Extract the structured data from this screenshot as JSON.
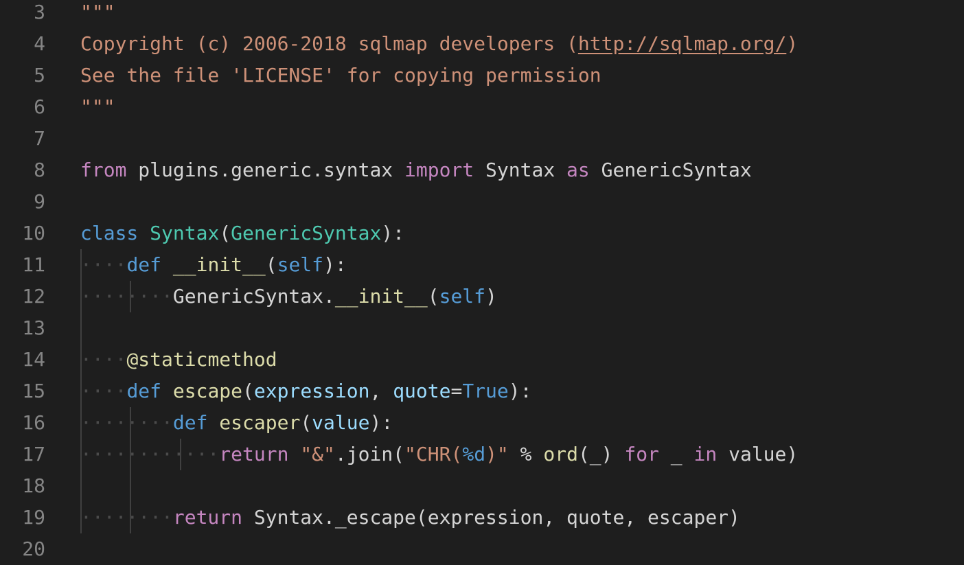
{
  "editor": {
    "colors": {
      "background": "#1e1e1e",
      "line_number": "#858585",
      "string": "#ce9178",
      "keyword": "#c586c0",
      "storage": "#569cd6",
      "class_name": "#4ec9b0",
      "function": "#dcdcaa",
      "parameter": "#9cdcfe",
      "plain": "#d4d4d4"
    },
    "lines": [
      {
        "number": "3",
        "tokens": [
          {
            "text": "\"\"\"",
            "kind": "string"
          }
        ]
      },
      {
        "number": "4",
        "tokens": [
          {
            "text": "Copyright (c) 2006-2018 sqlmap developers (",
            "kind": "string"
          },
          {
            "text": "http://sqlmap.org/",
            "kind": "link"
          },
          {
            "text": ")",
            "kind": "string"
          }
        ]
      },
      {
        "number": "5",
        "tokens": [
          {
            "text": "See the file 'LICENSE' for copying permission",
            "kind": "string"
          }
        ]
      },
      {
        "number": "6",
        "tokens": [
          {
            "text": "\"\"\"",
            "kind": "string"
          }
        ]
      },
      {
        "number": "7",
        "tokens": []
      },
      {
        "number": "8",
        "tokens": [
          {
            "text": "from",
            "kind": "keyword"
          },
          {
            "text": " plugins.generic.syntax ",
            "kind": "plain"
          },
          {
            "text": "import",
            "kind": "keyword"
          },
          {
            "text": " Syntax ",
            "kind": "plain"
          },
          {
            "text": "as",
            "kind": "keyword"
          },
          {
            "text": " GenericSyntax",
            "kind": "plain"
          }
        ]
      },
      {
        "number": "9",
        "tokens": []
      },
      {
        "number": "10",
        "tokens": [
          {
            "text": "class",
            "kind": "storage"
          },
          {
            "text": " ",
            "kind": "plain"
          },
          {
            "text": "Syntax",
            "kind": "class"
          },
          {
            "text": "(",
            "kind": "plain"
          },
          {
            "text": "GenericSyntax",
            "kind": "class"
          },
          {
            "text": "):",
            "kind": "plain"
          }
        ]
      },
      {
        "number": "11",
        "tokens": [
          {
            "text": "····",
            "kind": "ws"
          },
          {
            "text": "def",
            "kind": "storage"
          },
          {
            "text": " ",
            "kind": "plain"
          },
          {
            "text": "__init__",
            "kind": "func"
          },
          {
            "text": "(",
            "kind": "plain"
          },
          {
            "text": "self",
            "kind": "self"
          },
          {
            "text": "):",
            "kind": "plain"
          }
        ]
      },
      {
        "number": "12",
        "tokens": [
          {
            "text": "········",
            "kind": "ws"
          },
          {
            "text": "GenericSyntax.",
            "kind": "plain"
          },
          {
            "text": "__init__",
            "kind": "func"
          },
          {
            "text": "(",
            "kind": "plain"
          },
          {
            "text": "self",
            "kind": "self"
          },
          {
            "text": ")",
            "kind": "plain"
          }
        ]
      },
      {
        "number": "13",
        "tokens": []
      },
      {
        "number": "14",
        "tokens": [
          {
            "text": "····",
            "kind": "ws"
          },
          {
            "text": "@staticmethod",
            "kind": "decor"
          }
        ]
      },
      {
        "number": "15",
        "tokens": [
          {
            "text": "····",
            "kind": "ws"
          },
          {
            "text": "def",
            "kind": "storage"
          },
          {
            "text": " ",
            "kind": "plain"
          },
          {
            "text": "escape",
            "kind": "func"
          },
          {
            "text": "(",
            "kind": "plain"
          },
          {
            "text": "expression",
            "kind": "param"
          },
          {
            "text": ", ",
            "kind": "plain"
          },
          {
            "text": "quote",
            "kind": "param"
          },
          {
            "text": "=",
            "kind": "plain"
          },
          {
            "text": "True",
            "kind": "const"
          },
          {
            "text": "):",
            "kind": "plain"
          }
        ]
      },
      {
        "number": "16",
        "tokens": [
          {
            "text": "········",
            "kind": "ws"
          },
          {
            "text": "def",
            "kind": "storage"
          },
          {
            "text": " ",
            "kind": "plain"
          },
          {
            "text": "escaper",
            "kind": "func"
          },
          {
            "text": "(",
            "kind": "plain"
          },
          {
            "text": "value",
            "kind": "param"
          },
          {
            "text": "):",
            "kind": "plain"
          }
        ]
      },
      {
        "number": "17",
        "tokens": [
          {
            "text": "············",
            "kind": "ws"
          },
          {
            "text": "return",
            "kind": "keyword"
          },
          {
            "text": " ",
            "kind": "plain"
          },
          {
            "text": "\"&\"",
            "kind": "string"
          },
          {
            "text": ".join(",
            "kind": "plain"
          },
          {
            "text": "\"CHR(",
            "kind": "string"
          },
          {
            "text": "%d",
            "kind": "format"
          },
          {
            "text": ")\"",
            "kind": "string"
          },
          {
            "text": " % ",
            "kind": "plain"
          },
          {
            "text": "ord",
            "kind": "func"
          },
          {
            "text": "(_) ",
            "kind": "plain"
          },
          {
            "text": "for",
            "kind": "keyword"
          },
          {
            "text": " _ ",
            "kind": "plain"
          },
          {
            "text": "in",
            "kind": "keyword"
          },
          {
            "text": " value)",
            "kind": "plain"
          }
        ]
      },
      {
        "number": "18",
        "tokens": []
      },
      {
        "number": "19",
        "tokens": [
          {
            "text": "········",
            "kind": "ws"
          },
          {
            "text": "return",
            "kind": "keyword"
          },
          {
            "text": " Syntax._escape(expression, quote, escaper)",
            "kind": "plain"
          }
        ]
      },
      {
        "number": "20",
        "tokens": []
      }
    ]
  }
}
